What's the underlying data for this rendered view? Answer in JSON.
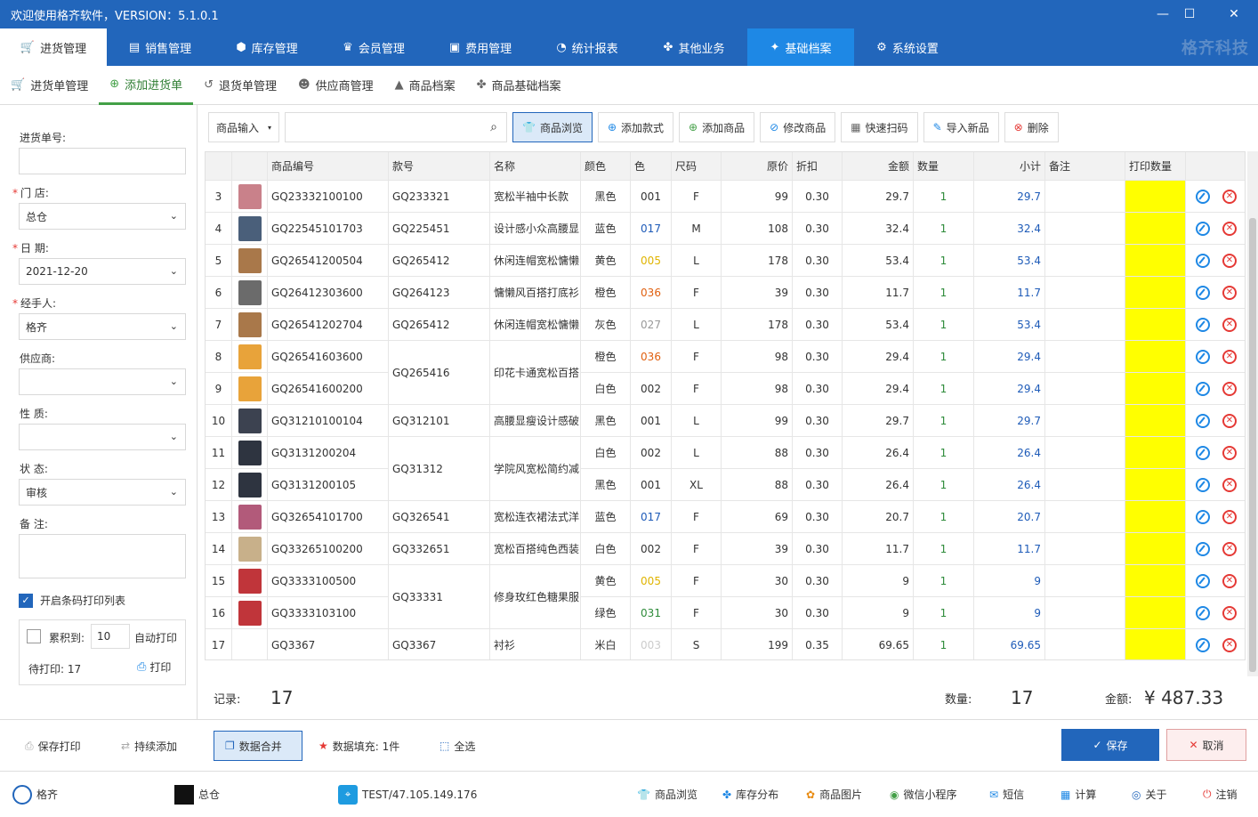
{
  "window": {
    "title": "欢迎使用格齐软件，VERSION：5.1.0.1",
    "minimize": "—",
    "maximize": "☐",
    "close": "✕"
  },
  "main_tabs": [
    {
      "label": "进货管理",
      "icon": "🛒"
    },
    {
      "label": "销售管理",
      "icon": "▤"
    },
    {
      "label": "库存管理",
      "icon": "⬢"
    },
    {
      "label": "会员管理",
      "icon": "♛"
    },
    {
      "label": "费用管理",
      "icon": "▣"
    },
    {
      "label": "统计报表",
      "icon": "◔"
    },
    {
      "label": "其他业务",
      "icon": "✤"
    },
    {
      "label": "基础档案",
      "icon": "✦"
    },
    {
      "label": "系统设置",
      "icon": "⚙"
    }
  ],
  "brand": "格齐科技",
  "sub_tabs": [
    {
      "label": "进货单管理",
      "icon": "🛒"
    },
    {
      "label": "添加进货单",
      "icon": "⊕"
    },
    {
      "label": "退货单管理",
      "icon": "↺"
    },
    {
      "label": "供应商管理",
      "icon": "☻"
    },
    {
      "label": "商品档案",
      "icon": "▲"
    },
    {
      "label": "商品基础档案",
      "icon": "✤"
    }
  ],
  "form": {
    "order_no_label": "进货单号:",
    "order_no": "",
    "store_label": "门  店:",
    "store": "总仓",
    "date_label": "日  期:",
    "date": "2021-12-20",
    "handler_label": "经手人:",
    "handler": "格齐",
    "supplier_label": "供应商:",
    "supplier": "",
    "nature_label": "性  质:",
    "nature": "",
    "status_label": "状  态:",
    "status": "审核",
    "remark_label": "备  注:",
    "remark": "",
    "barcode_print_label": "开启条码打印列表",
    "accumulate_label": "累积到:",
    "accumulate_value": "10",
    "auto_print_label": "自动打印",
    "pending_label": "待打印: 17",
    "print_label": "打印"
  },
  "toolbar": {
    "input_mode": "商品输入",
    "search_value": "",
    "buttons": [
      "商品浏览",
      "添加款式",
      "添加商品",
      "修改商品",
      "快速扫码",
      "导入新品",
      "删除"
    ]
  },
  "columns": [
    "",
    "",
    "商品编号",
    "款号",
    "名称",
    "颜色",
    "色",
    "尺码",
    "原价",
    "折扣",
    "金额",
    "数量",
    "小计",
    "备注",
    "打印数量",
    ""
  ],
  "rows": [
    {
      "n": "3",
      "img": "#c9818a",
      "code": "GQ23332100100",
      "style": "GQ233321",
      "name": "宽松半袖中长款",
      "color": "黑色",
      "cc": "001",
      "ccolor": "#333",
      "size": "F",
      "price": "99",
      "disc": "0.30",
      "amt": "29.7",
      "qty": "1",
      "sub": "29.7"
    },
    {
      "n": "4",
      "img": "#4a5f7a",
      "code": "GQ22545101703",
      "style": "GQ225451",
      "name": "设计感小众高腰显",
      "color": "蓝色",
      "cc": "017",
      "ccolor": "#1e5bb8",
      "size": "M",
      "price": "108",
      "disc": "0.30",
      "amt": "32.4",
      "qty": "1",
      "sub": "32.4"
    },
    {
      "n": "5",
      "img": "#a9784a",
      "code": "GQ26541200504",
      "style": "GQ265412",
      "name": "休闲连帽宽松慵懒",
      "color": "黄色",
      "cc": "005",
      "ccolor": "#e0b400",
      "size": "L",
      "price": "178",
      "disc": "0.30",
      "amt": "53.4",
      "qty": "1",
      "sub": "53.4"
    },
    {
      "n": "6",
      "img": "#6b6b6b",
      "code": "GQ26412303600",
      "style": "GQ264123",
      "name": "慵懒风百搭打底衫",
      "color": "橙色",
      "cc": "036",
      "ccolor": "#e06010",
      "size": "F",
      "price": "39",
      "disc": "0.30",
      "amt": "11.7",
      "qty": "1",
      "sub": "11.7"
    },
    {
      "n": "7",
      "img": "#a9784a",
      "code": "GQ26541202704",
      "style": "GQ265412",
      "name": "休闲连帽宽松慵懒",
      "color": "灰色",
      "cc": "027",
      "ccolor": "#999",
      "size": "L",
      "price": "178",
      "disc": "0.30",
      "amt": "53.4",
      "qty": "1",
      "sub": "53.4"
    },
    {
      "n": "8",
      "img": "#e8a33a",
      "code": "GQ26541603600",
      "style": "",
      "name": "",
      "color": "橙色",
      "cc": "036",
      "ccolor": "#e06010",
      "size": "F",
      "price": "98",
      "disc": "0.30",
      "amt": "29.4",
      "qty": "1",
      "sub": "29.4"
    },
    {
      "n": "9",
      "img": "#e8a33a",
      "code": "GQ26541600200",
      "style": "",
      "name": "",
      "color": "白色",
      "cc": "002",
      "ccolor": "#333",
      "size": "F",
      "price": "98",
      "disc": "0.30",
      "amt": "29.4",
      "qty": "1",
      "sub": "29.4"
    },
    {
      "n": "10",
      "img": "#3c4250",
      "code": "GQ31210100104",
      "style": "GQ312101",
      "name": "高腰显瘦设计感破",
      "color": "黑色",
      "cc": "001",
      "ccolor": "#333",
      "size": "L",
      "price": "99",
      "disc": "0.30",
      "amt": "29.7",
      "qty": "1",
      "sub": "29.7"
    },
    {
      "n": "11",
      "img": "#2e3440",
      "code": "GQ3131200204",
      "style": "",
      "name": "",
      "color": "白色",
      "cc": "002",
      "ccolor": "#333",
      "size": "L",
      "price": "88",
      "disc": "0.30",
      "amt": "26.4",
      "qty": "1",
      "sub": "26.4"
    },
    {
      "n": "12",
      "img": "#2e3440",
      "code": "GQ3131200105",
      "style": "",
      "name": "",
      "color": "黑色",
      "cc": "001",
      "ccolor": "#333",
      "size": "XL",
      "price": "88",
      "disc": "0.30",
      "amt": "26.4",
      "qty": "1",
      "sub": "26.4"
    },
    {
      "n": "13",
      "img": "#b25a7a",
      "code": "GQ32654101700",
      "style": "GQ326541",
      "name": "宽松连衣裙法式洋",
      "color": "蓝色",
      "cc": "017",
      "ccolor": "#1e5bb8",
      "size": "F",
      "price": "69",
      "disc": "0.30",
      "amt": "20.7",
      "qty": "1",
      "sub": "20.7"
    },
    {
      "n": "14",
      "img": "#c8b08a",
      "code": "GQ33265100200",
      "style": "GQ332651",
      "name": "宽松百搭纯色西装",
      "color": "白色",
      "cc": "002",
      "ccolor": "#333",
      "size": "F",
      "price": "39",
      "disc": "0.30",
      "amt": "11.7",
      "qty": "1",
      "sub": "11.7"
    },
    {
      "n": "15",
      "img": "#c0353a",
      "code": "GQ3333100500",
      "style": "",
      "name": "",
      "color": "黄色",
      "cc": "005",
      "ccolor": "#e0b400",
      "size": "F",
      "price": "30",
      "disc": "0.30",
      "amt": "9",
      "qty": "1",
      "sub": "9"
    },
    {
      "n": "16",
      "img": "#c0353a",
      "code": "GQ3333103100",
      "style": "",
      "name": "",
      "color": "绿色",
      "cc": "031",
      "ccolor": "#2e8b3a",
      "size": "F",
      "price": "30",
      "disc": "0.30",
      "amt": "9",
      "qty": "1",
      "sub": "9"
    },
    {
      "n": "17",
      "img": "",
      "code": "GQ3367",
      "style": "GQ3367",
      "name": "衬衫",
      "color": "米白",
      "cc": "003",
      "ccolor": "#ccc",
      "size": "S",
      "price": "199",
      "disc": "0.35",
      "amt": "69.65",
      "qty": "1",
      "sub": "69.65"
    }
  ],
  "merged": [
    {
      "rows": [
        8,
        9
      ],
      "style": "GQ265416",
      "name": "印花卡通宽松百搭"
    },
    {
      "rows": [
        11,
        12
      ],
      "style": "GQ31312",
      "name": "学院风宽松简约减"
    },
    {
      "rows": [
        15,
        16
      ],
      "style": "GQ33331",
      "name": "修身玫红色糖果服"
    }
  ],
  "summary": {
    "records_label": "记录:",
    "records": "17",
    "qty_label": "数量:",
    "qty": "17",
    "amount_label": "金额:",
    "amount": "¥ 487.33"
  },
  "bottom": {
    "save_print": "保存打印",
    "continue_add": "持续添加",
    "merge": "数据合并",
    "fill": "数据填充:  1件",
    "select_all": "全选",
    "save": "保存",
    "cancel": "取消"
  },
  "status": {
    "user": "格齐",
    "store": "总仓",
    "server": "TEST/47.105.149.176",
    "links": [
      "商品浏览",
      "库存分布",
      "商品图片",
      "微信小程序",
      "短信",
      "计算",
      "关于",
      "注销"
    ]
  },
  "colors": {
    "primary": "#2266bb",
    "highlight_tab": "#1e88e5",
    "print_qty": "#ffff00",
    "subtotal": "#1e5bb8",
    "qty": "#2e8b3a"
  }
}
